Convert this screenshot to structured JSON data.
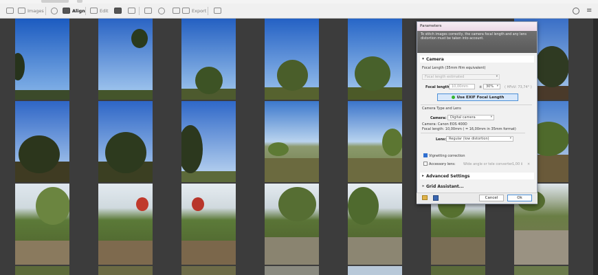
{
  "toolbar": {
    "images": "Images",
    "align": "Align",
    "edit": "Edit",
    "export": "Export"
  },
  "icons": [
    "grid-icon",
    "camera-icon",
    "align-icon",
    "edit-icon",
    "layers-icon",
    "crop-icon",
    "adjust-icon",
    "color-icon",
    "mask-icon",
    "export-icon",
    "print-icon",
    "theme-icon",
    "menu-icon"
  ],
  "dialog": {
    "title": "Parameters",
    "banner": "To stitch images correctly, the camera focal length and any lens distortion must be taken into account.",
    "camera_section": "Camera",
    "focal_length_35": "Focal Length (35mm film equivalent)",
    "focal_estimated": "Focal length estimated",
    "focal_length_label": "Focal length:",
    "focal_value": "10,00mm",
    "pm": "±",
    "tolerance": "30%",
    "hfov": "( HFoV: 73,74° )",
    "exif_button": "Use EXIF Focal Length",
    "camera_type_lens": "Camera Type and Lens",
    "camera_label": "Camera:",
    "camera_value": "Digital camera",
    "camera_model": "Camera: Canon EOS 400D",
    "camera_focal": "Focal length: 10,00mm ( = 16,00mm in 35mm format)",
    "lens_label": "Lens:",
    "lens_value": "Regular  (low distortion)",
    "vignetting": "Vignetting correction",
    "accessory": "Accessory lens:",
    "accessory_value": "Wide angle or tele converter",
    "accessory_factor": "1,00",
    "advanced": "Advanced Settings",
    "grid_assistant": "Grid Assistant...",
    "cancel": "Cancel",
    "ok": "Ok"
  },
  "colors": {
    "accent": "#4b8fd6",
    "exif_dot": "#34b52f",
    "vignetting_checked": "#2f6fd0"
  }
}
